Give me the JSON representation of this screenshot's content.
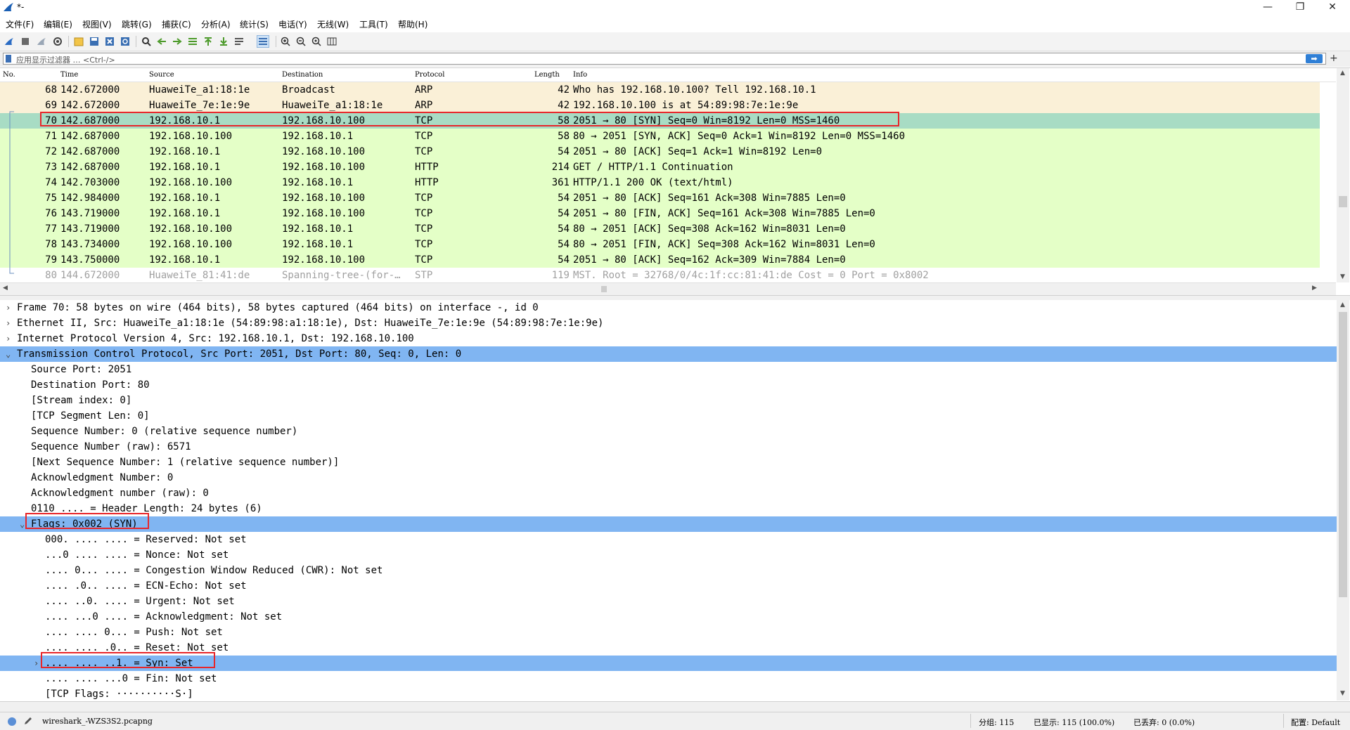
{
  "window": {
    "title": "*-",
    "min": "—",
    "max": "❐",
    "close": "✕"
  },
  "menu": [
    "文件(F)",
    "编辑(E)",
    "视图(V)",
    "跳转(G)",
    "捕获(C)",
    "分析(A)",
    "统计(S)",
    "电话(Y)",
    "无线(W)",
    "工具(T)",
    "帮助(H)"
  ],
  "filter": {
    "placeholder": "应用显示过滤器 … <Ctrl-/>",
    "apply": "➡",
    "add": "+"
  },
  "columns": {
    "no": "No.",
    "time": "Time",
    "source": "Source",
    "destination": "Destination",
    "protocol": "Protocol",
    "length": "Length",
    "info": "Info"
  },
  "colors": {
    "arp": "#faf0d7",
    "tcp": "#e4ffc7",
    "selected": "#a8dcc4",
    "stp": "#ffffff",
    "detail_selected": "#80b5f2",
    "highlight_box": "#e8262a"
  },
  "packets": [
    {
      "no": "68",
      "time": "142.672000",
      "source": "HuaweiTe_a1:18:1e",
      "destination": "Broadcast",
      "protocol": "ARP",
      "length": "42",
      "info": "Who has 192.168.10.100? Tell 192.168.10.1"
    },
    {
      "no": "69",
      "time": "142.672000",
      "source": "HuaweiTe_7e:1e:9e",
      "destination": "HuaweiTe_a1:18:1e",
      "protocol": "ARP",
      "length": "42",
      "info": "192.168.10.100 is at 54:89:98:7e:1e:9e"
    },
    {
      "no": "70",
      "time": "142.687000",
      "source": "192.168.10.1",
      "destination": "192.168.10.100",
      "protocol": "TCP",
      "length": "58",
      "info": "2051 → 80 [SYN] Seq=0 Win=8192 Len=0 MSS=1460"
    },
    {
      "no": "71",
      "time": "142.687000",
      "source": "192.168.10.100",
      "destination": "192.168.10.1",
      "protocol": "TCP",
      "length": "58",
      "info": "80 → 2051 [SYN, ACK] Seq=0 Ack=1 Win=8192 Len=0 MSS=1460"
    },
    {
      "no": "72",
      "time": "142.687000",
      "source": "192.168.10.1",
      "destination": "192.168.10.100",
      "protocol": "TCP",
      "length": "54",
      "info": "2051 → 80 [ACK] Seq=1 Ack=1 Win=8192 Len=0"
    },
    {
      "no": "73",
      "time": "142.687000",
      "source": "192.168.10.1",
      "destination": "192.168.10.100",
      "protocol": "HTTP",
      "length": "214",
      "info": "GET / HTTP/1.1 Continuation"
    },
    {
      "no": "74",
      "time": "142.703000",
      "source": "192.168.10.100",
      "destination": "192.168.10.1",
      "protocol": "HTTP",
      "length": "361",
      "info": "HTTP/1.1 200 OK  (text/html)"
    },
    {
      "no": "75",
      "time": "142.984000",
      "source": "192.168.10.1",
      "destination": "192.168.10.100",
      "protocol": "TCP",
      "length": "54",
      "info": "2051 → 80 [ACK] Seq=161 Ack=308 Win=7885 Len=0"
    },
    {
      "no": "76",
      "time": "143.719000",
      "source": "192.168.10.1",
      "destination": "192.168.10.100",
      "protocol": "TCP",
      "length": "54",
      "info": "2051 → 80 [FIN, ACK] Seq=161 Ack=308 Win=7885 Len=0"
    },
    {
      "no": "77",
      "time": "143.719000",
      "source": "192.168.10.100",
      "destination": "192.168.10.1",
      "protocol": "TCP",
      "length": "54",
      "info": "80 → 2051 [ACK] Seq=308 Ack=162 Win=8031 Len=0"
    },
    {
      "no": "78",
      "time": "143.734000",
      "source": "192.168.10.100",
      "destination": "192.168.10.1",
      "protocol": "TCP",
      "length": "54",
      "info": "80 → 2051 [FIN, ACK] Seq=308 Ack=162 Win=8031 Len=0"
    },
    {
      "no": "79",
      "time": "143.750000",
      "source": "192.168.10.1",
      "destination": "192.168.10.100",
      "protocol": "TCP",
      "length": "54",
      "info": "2051 → 80 [ACK] Seq=162 Ack=309 Win=7884 Len=0"
    },
    {
      "no": "80",
      "time": "144.672000",
      "source": "HuaweiTe_81:41:de",
      "destination": "Spanning-tree-(for-…",
      "protocol": "STP",
      "length": "119",
      "info": "MST. Root = 32768/0/4c:1f:cc:81:41:de  Cost = 0  Port = 0x8002"
    }
  ],
  "details": [
    {
      "arrow": "›",
      "text": "Frame 70: 58 bytes on wire (464 bits), 58 bytes captured (464 bits) on interface -, id 0"
    },
    {
      "arrow": "›",
      "text": "Ethernet II, Src: HuaweiTe_a1:18:1e (54:89:98:a1:18:1e), Dst: HuaweiTe_7e:1e:9e (54:89:98:7e:1e:9e)"
    },
    {
      "arrow": "›",
      "text": "Internet Protocol Version 4, Src: 192.168.10.1, Dst: 192.168.10.100"
    },
    {
      "arrow": "⌄",
      "text": "Transmission Control Protocol, Src Port: 2051, Dst Port: 80, Seq: 0, Len: 0"
    },
    {
      "arrow": "",
      "text": "Source Port: 2051"
    },
    {
      "arrow": "",
      "text": "Destination Port: 80"
    },
    {
      "arrow": "",
      "text": "[Stream index: 0]"
    },
    {
      "arrow": "",
      "text": "[TCP Segment Len: 0]"
    },
    {
      "arrow": "",
      "text": "Sequence Number: 0    (relative sequence number)"
    },
    {
      "arrow": "",
      "text": "Sequence Number (raw): 6571"
    },
    {
      "arrow": "",
      "text": "[Next Sequence Number: 1    (relative sequence number)]"
    },
    {
      "arrow": "",
      "text": "Acknowledgment Number: 0"
    },
    {
      "arrow": "",
      "text": "Acknowledgment number (raw): 0"
    },
    {
      "arrow": "",
      "text": "0110 .... = Header Length: 24 bytes (6)"
    },
    {
      "arrow": "⌄",
      "text": "Flags: 0x002 (SYN)"
    },
    {
      "arrow": "",
      "text": "000. .... .... = Reserved: Not set"
    },
    {
      "arrow": "",
      "text": "...0 .... .... = Nonce: Not set"
    },
    {
      "arrow": "",
      "text": ".... 0... .... = Congestion Window Reduced (CWR): Not set"
    },
    {
      "arrow": "",
      "text": ".... .0.. .... = ECN-Echo: Not set"
    },
    {
      "arrow": "",
      "text": ".... ..0. .... = Urgent: Not set"
    },
    {
      "arrow": "",
      "text": ".... ...0 .... = Acknowledgment: Not set"
    },
    {
      "arrow": "",
      "text": ".... .... 0... = Push: Not set"
    },
    {
      "arrow": "",
      "text": ".... .... .0.. = Reset: Not set"
    },
    {
      "arrow": "›",
      "text": ".... .... ..1. = Syn: Set"
    },
    {
      "arrow": "",
      "text": ".... .... ...0 = Fin: Not set"
    },
    {
      "arrow": "",
      "text": "[TCP Flags: ··········S·]"
    }
  ],
  "status": {
    "file": "wireshark_-WZS3S2.pcapng",
    "packets": "分组: 115",
    "displayed": "已显示: 115 (100.0%)",
    "dropped": "已丢弃: 0 (0.0%)",
    "profile": "配置: Default"
  }
}
